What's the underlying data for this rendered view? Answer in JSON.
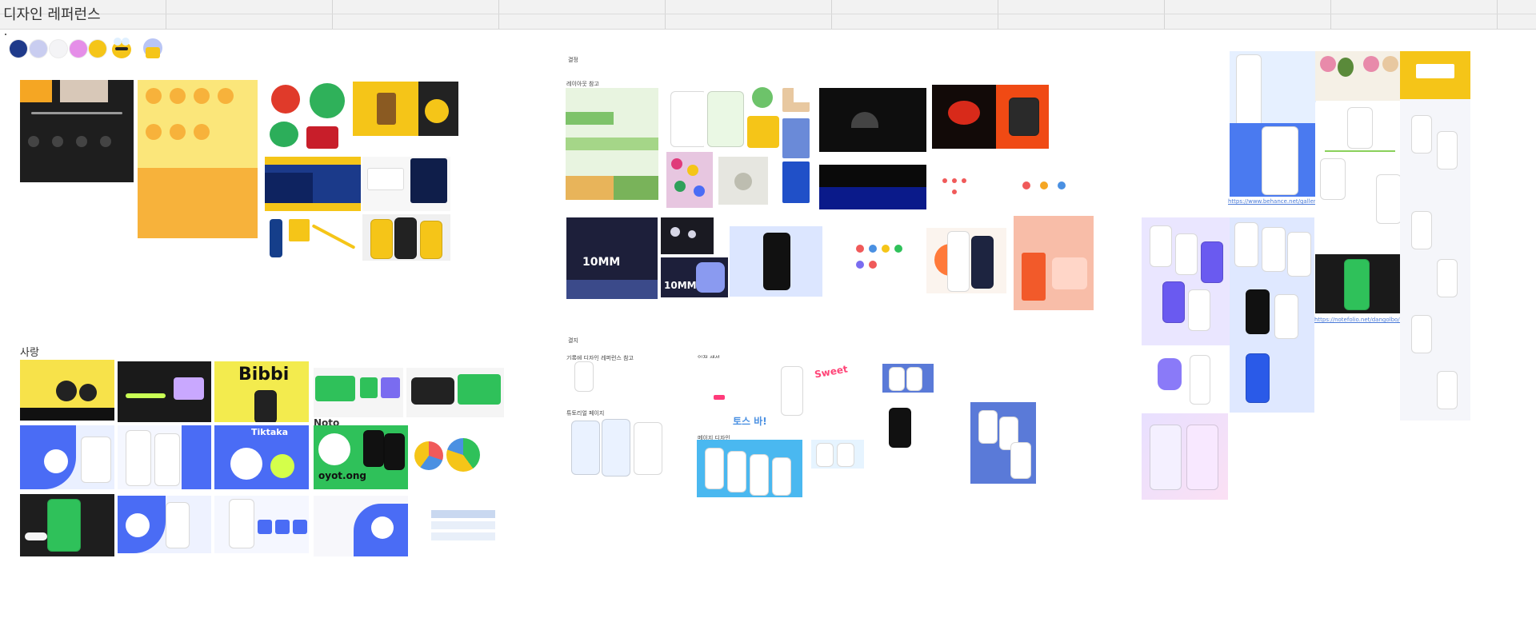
{
  "board": {
    "title": "디자인 레퍼런스",
    "bottom_caption": "",
    "colors": {
      "navy": "#1f3a8a",
      "lavender": "#c9cdf0",
      "white": "#f6f6f6",
      "pink": "#e58ee8",
      "yellow": "#f5c518"
    }
  },
  "swatches": [
    {
      "color": "#1f3a8a"
    },
    {
      "color": "#c9cdf0"
    },
    {
      "color": "#f4f4f6"
    },
    {
      "color": "#e58ee8"
    },
    {
      "color": "#f5c518"
    }
  ],
  "sections": {
    "top_middle": "결정",
    "layout_ref": "레이아웃 참고",
    "mid_label": "결지",
    "sarang": "사랑",
    "left_caption_1": "기록에 디자인 레퍼런스 참고",
    "left_caption_2": "튜토리얼 페이지",
    "center_caption_1": "일정 생성",
    "center_caption_2": "메이지 디자인"
  },
  "thumb_text": {
    "bibbi": "Bibbi",
    "tiktaka": "Tiktaka",
    "mm1": "10MM",
    "mm2": "10MM",
    "sweet": "Sweet",
    "ribbon": "토스 바!",
    "bee": "bee app",
    "noto": "Noto",
    "oyot": "oyot.ong"
  },
  "links": {
    "behance": "https://www.behance.net/gallery/158046773",
    "notefolio": "https://notefolio.net/dangolbo/344728"
  }
}
